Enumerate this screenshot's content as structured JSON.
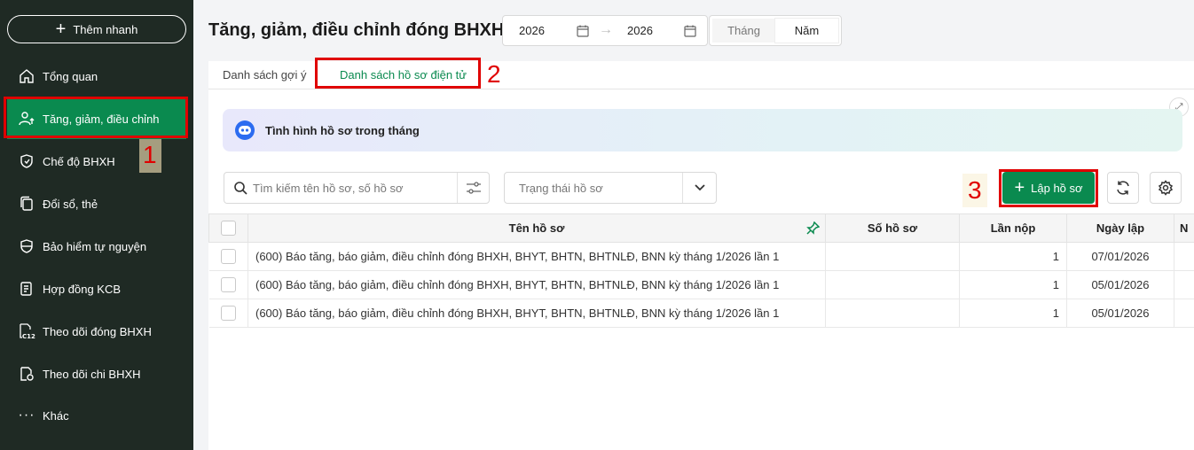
{
  "sidebar": {
    "quick_add": "Thêm nhanh",
    "items": [
      {
        "label": "Tổng quan",
        "icon": "home-icon"
      },
      {
        "label": "Tăng, giảm, điều chỉnh",
        "icon": "user-up-icon"
      },
      {
        "label": "Chế độ BHXH",
        "icon": "shield-heart-icon"
      },
      {
        "label": "Đổi sổ, thẻ",
        "icon": "copy-icon"
      },
      {
        "label": "Bảo hiểm tự nguyện",
        "icon": "shield-icon"
      },
      {
        "label": "Hợp đồng KCB",
        "icon": "contract-icon"
      },
      {
        "label": "Theo dõi đóng BHXH",
        "icon": "c12-doc-icon"
      },
      {
        "label": "Theo dõi chi BHXH",
        "icon": "money-doc-icon"
      },
      {
        "label": "Khác",
        "icon": "more-icon"
      }
    ]
  },
  "annotations": {
    "step1": "1",
    "step2": "2",
    "step3": "3"
  },
  "header": {
    "title": "Tăng, giảm, điều chỉnh đóng BHXH",
    "date_from": "2026",
    "date_to": "2026",
    "period_month": "Tháng",
    "period_year": "Năm"
  },
  "tabs": {
    "suggest": "Danh sách gợi ý",
    "electronic": "Danh sách hồ sơ điện tử"
  },
  "banner": {
    "text": "Tình hình hồ sơ trong tháng"
  },
  "toolbar": {
    "search_placeholder": "Tìm kiếm tên hồ sơ, số hồ sơ",
    "status_placeholder": "Trạng thái hồ sơ",
    "create_label": "Lập hồ sơ"
  },
  "table": {
    "columns": [
      "Tên hồ sơ",
      "Số hồ sơ",
      "Lần nộp",
      "Ngày lập",
      "N"
    ],
    "rows": [
      {
        "name": "(600) Báo tăng, báo giảm, điều chỉnh đóng BHXH, BHYT, BHTN, BHTNLĐ, BNN kỳ tháng 1/2026 lần 1",
        "number": "",
        "submit": "1",
        "date": "07/01/2026"
      },
      {
        "name": "(600) Báo tăng, báo giảm, điều chỉnh đóng BHXH, BHYT, BHTN, BHTNLĐ, BNN kỳ tháng 1/2026 lần 1",
        "number": "",
        "submit": "1",
        "date": "05/01/2026"
      },
      {
        "name": "(600) Báo tăng, báo giảm, điều chỉnh đóng BHXH, BHYT, BHTN, BHTNLĐ, BNN kỳ tháng 1/2026 lần 1",
        "number": "",
        "submit": "1",
        "date": "05/01/2026"
      }
    ]
  },
  "colors": {
    "accent": "#0a8a4f",
    "sidebar_bg": "#1f2a24",
    "annotation_red": "#e00000"
  }
}
